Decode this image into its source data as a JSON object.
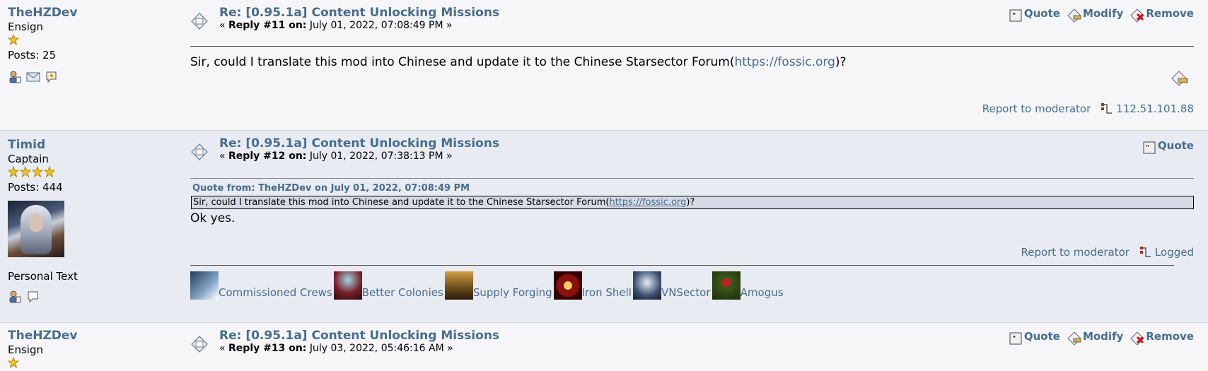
{
  "posts": [
    {
      "author": "TheHZDev",
      "rank": "Ensign",
      "stars": 1,
      "posts_label": "Posts: 25",
      "subject": "Re: [0.95.1a] Content Unlocking Missions",
      "reply_prefix": "« ",
      "reply_label": "Reply #11 on:",
      "reply_date": " July 01, 2022, 07:08:49 PM »",
      "actions": {
        "quote": "Quote",
        "modify": "Modify",
        "remove": "Remove"
      },
      "body_before": "Sir, could I translate this mod into Chinese and update it to the Chinese Starsector Forum(",
      "body_link": "https://fossic.org",
      "body_after": ")?",
      "report": "Report to moderator",
      "ip": "112.51.101.88"
    },
    {
      "author": "Timid",
      "rank": "Captain",
      "stars": 4,
      "posts_label": "Posts: 444",
      "personal_text": "Personal Text",
      "subject": "Re: [0.95.1a] Content Unlocking Missions",
      "reply_prefix": "« ",
      "reply_label": "Reply #12 on:",
      "reply_date": " July 01, 2022, 07:38:13 PM »",
      "actions": {
        "quote": "Quote"
      },
      "quote_header": "Quote from: TheHZDev on July 01, 2022, 07:08:49 PM",
      "quote_before": "Sir, could I translate this mod into Chinese and update it to the Chinese Starsector Forum(",
      "quote_link": "https://fossic.org",
      "quote_after": ")?",
      "body": "Ok yes.",
      "report": "Report to moderator",
      "logged": "Logged",
      "signature": [
        {
          "label": "Commissioned Crews",
          "color": "#1f3c5a"
        },
        {
          "label": "Better Colonies",
          "color": "#7a1f2a"
        },
        {
          "label": "Supply Forging",
          "color": "#6a4a1c"
        },
        {
          "label": "Iron Shell",
          "color": "#8a1010"
        },
        {
          "label": "VNSector",
          "color": "#3a4f6e"
        },
        {
          "label": "Amogus",
          "color": "#3c5a1a"
        }
      ]
    },
    {
      "author": "TheHZDev",
      "rank": "Ensign",
      "stars": 1,
      "subject": "Re: [0.95.1a] Content Unlocking Missions",
      "reply_prefix": "« ",
      "reply_label": "Reply #13 on:",
      "reply_date": " July 03, 2022, 05:46:16 AM »",
      "actions": {
        "quote": "Quote",
        "modify": "Modify",
        "remove": "Remove"
      }
    }
  ],
  "colors": {
    "link": "#476c8e",
    "star": "#f2c31b"
  }
}
